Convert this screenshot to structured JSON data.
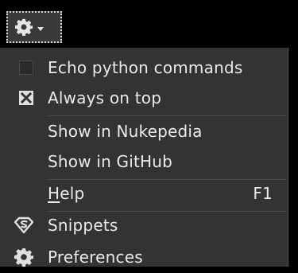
{
  "toolbar": {
    "gear_icon": "gear-icon",
    "dropdown_icon": "chevron-down-icon"
  },
  "menu": {
    "items": [
      {
        "label": "Echo python commands",
        "checked": false
      },
      {
        "label": "Always on top",
        "checked": true
      },
      {
        "label": "Show in Nukepedia"
      },
      {
        "label": "Show in GitHub"
      },
      {
        "label_pre": "",
        "label_accel": "H",
        "label_post": "elp",
        "shortcut": "F1"
      },
      {
        "label": "Snippets",
        "icon": "superman-logo-icon"
      },
      {
        "label": "Preferences",
        "icon": "gear-icon"
      }
    ]
  },
  "colors": {
    "menu_bg": "#333333",
    "text": "#eaeaea",
    "separator": "#4a4a4a",
    "gear_button_bg": "#3a3a3a",
    "window_bg": "#000000"
  }
}
